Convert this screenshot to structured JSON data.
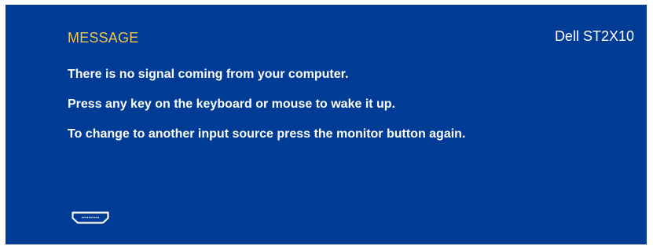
{
  "osd": {
    "title": "MESSAGE",
    "model": "Dell ST2X10",
    "lines": [
      "There is no signal coming from your computer.",
      "Press any key on the keyboard or mouse to wake it up.",
      "To change to another input source press the monitor button again."
    ],
    "input_icon": "hdmi-port-icon",
    "colors": {
      "background": "#003c96",
      "title": "#f2c64a",
      "text": "#ffffff"
    }
  }
}
